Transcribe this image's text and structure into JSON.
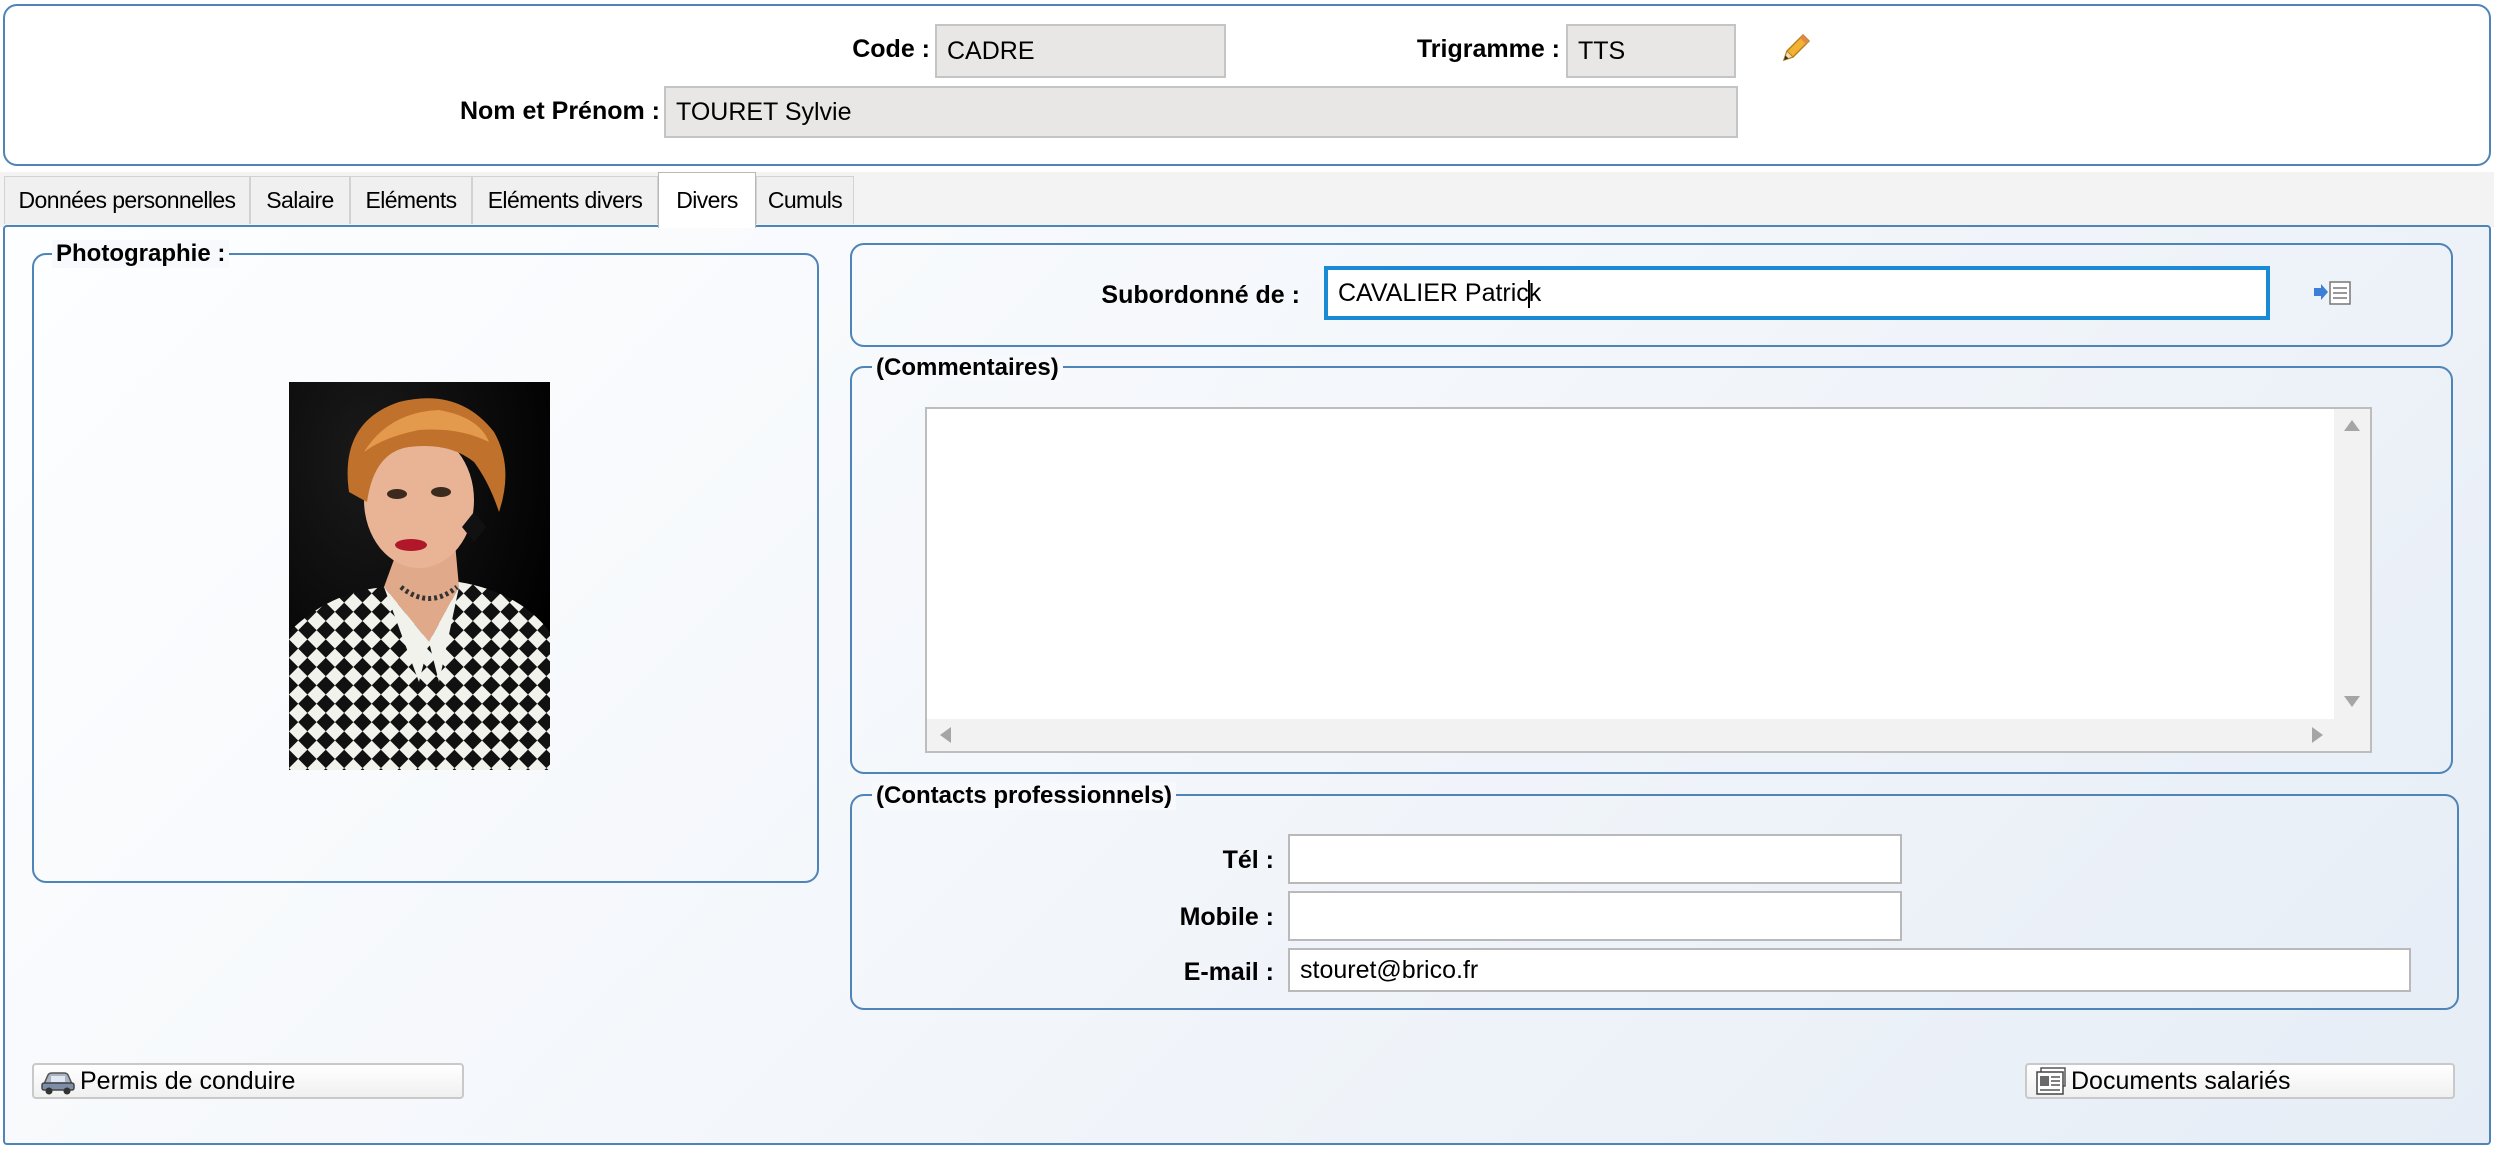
{
  "header": {
    "code_label": "Code :",
    "code_value": "CADRE",
    "trigramme_label": "Trigramme :",
    "trigramme_value": "TTS",
    "nom_label": "Nom et Prénom :",
    "nom_value": "TOURET Sylvie"
  },
  "tabs": [
    {
      "label": "Données personnelles"
    },
    {
      "label": "Salaire"
    },
    {
      "label": "Eléments"
    },
    {
      "label": "Eléments divers"
    },
    {
      "label": "Divers",
      "active": true
    },
    {
      "label": "Cumuls"
    }
  ],
  "photo_panel": {
    "legend": "Photographie :"
  },
  "subordonne": {
    "label": "Subordonné de :",
    "value": "CAVALIER Patrick"
  },
  "commentaires": {
    "legend": "(Commentaires)",
    "value": ""
  },
  "contacts": {
    "legend": "(Contacts professionnels)",
    "tel_label": "Tél :",
    "tel_value": "",
    "mobile_label": "Mobile :",
    "mobile_value": "",
    "email_label": "E-mail :",
    "email_value": "stouret@brico.fr"
  },
  "buttons": {
    "permis": "Permis de conduire",
    "documents": "Documents salariés"
  },
  "colors": {
    "panel_border": "#4e84b8",
    "focus_border": "#1a8ad4",
    "readonly_bg": "#e8e7e5"
  },
  "icons": [
    "pencil-icon",
    "select-list-icon",
    "car-icon",
    "documents-icon"
  ]
}
